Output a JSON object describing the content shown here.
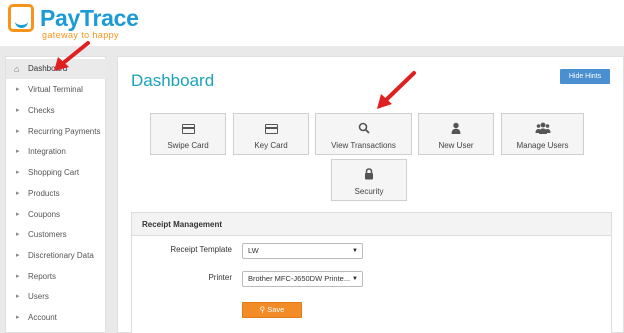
{
  "brand": {
    "name_pay": "Pay",
    "name_trace": "Trace",
    "tagline": "gateway to happy"
  },
  "sidebar": {
    "items": [
      {
        "label": "Dashboard",
        "icon": "home-icon"
      },
      {
        "label": "Virtual Terminal"
      },
      {
        "label": "Checks"
      },
      {
        "label": "Recurring Payments"
      },
      {
        "label": "Integration"
      },
      {
        "label": "Shopping Cart"
      },
      {
        "label": "Products"
      },
      {
        "label": "Coupons"
      },
      {
        "label": "Customers"
      },
      {
        "label": "Discretionary Data"
      },
      {
        "label": "Reports"
      },
      {
        "label": "Users"
      },
      {
        "label": "Account"
      }
    ]
  },
  "main": {
    "title": "Dashboard",
    "hide_hints": "Hide Hints",
    "tiles": [
      {
        "label": "Swipe Card",
        "icon": "credit-card-icon"
      },
      {
        "label": "Key Card",
        "icon": "credit-card-icon"
      },
      {
        "label": "View Transactions",
        "icon": "search-icon"
      },
      {
        "label": "New User",
        "icon": "user-icon"
      },
      {
        "label": "Manage Users",
        "icon": "users-icon"
      },
      {
        "label": "Security",
        "icon": "lock-icon"
      }
    ]
  },
  "receipt": {
    "heading": "Receipt Management",
    "template_label": "Receipt Template",
    "template_value": "LW",
    "printer_label": "Printer",
    "printer_value": "Brother MFC-J650DW Printe...",
    "save_label": "Save"
  },
  "colors": {
    "accent": "#1aa3b8",
    "brand_blue": "#1c9bd7",
    "brand_orange": "#f7941e",
    "button_blue": "#4a8fcf",
    "save_orange": "#f28c28",
    "annotation_red": "#e02020"
  }
}
